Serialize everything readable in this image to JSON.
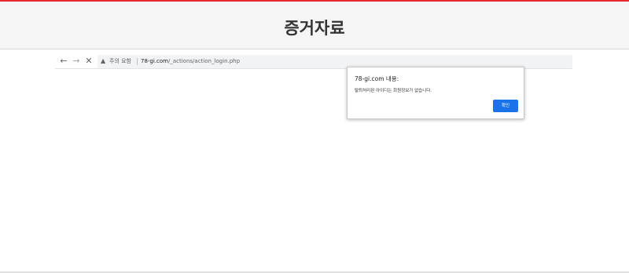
{
  "page": {
    "header_title": "증거자료"
  },
  "browser": {
    "nav": {
      "back_glyph": "←",
      "forward_glyph": "→",
      "stop_glyph": "✕"
    },
    "security_icon": "warning-icon",
    "security_label": "주의 요함",
    "url_domain": "78-gi.com",
    "url_path": "/_actions/action_login.php"
  },
  "alert": {
    "title": "78-gi.com 내용:",
    "message": "탈퇴처리된 아이디는 회원정보가 없습니다.",
    "ok_label": "확인"
  },
  "colors": {
    "accent_red": "#e8262d",
    "ok_button": "#1a73e8"
  }
}
